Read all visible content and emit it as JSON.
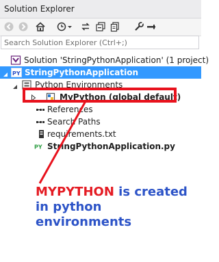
{
  "window": {
    "title": "Solution Explorer"
  },
  "toolbar": {
    "icons": [
      "back-icon",
      "forward-icon",
      "home-icon",
      "history-icon",
      "sync-icon",
      "collapse-all-icon",
      "show-all-files-icon",
      "properties-icon",
      "pin-icon"
    ]
  },
  "search": {
    "placeholder": "Search Solution Explorer (Ctrl+;)"
  },
  "tree": {
    "solution_label": "Solution 'StringPythonApplication' (1 project)",
    "project_label": "StringPythonApplication",
    "python_env_label": "Python Environments",
    "env_label": "MyPython (global default)",
    "references_label": "References",
    "search_paths_label": "Search Paths",
    "requirements_label": "requirements.txt",
    "main_file_label": "StringPythonApplication.py"
  },
  "annotation": {
    "keyword": "MYPYTHON",
    "text": "is created in python environments"
  },
  "colors": {
    "selection": "#3399ff",
    "highlight": "#e8121d",
    "annotation_keyword": "#e41b23",
    "annotation_text": "#2c53c7"
  }
}
